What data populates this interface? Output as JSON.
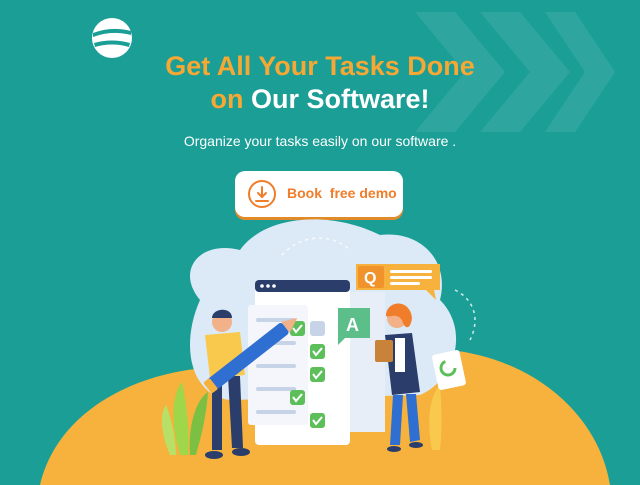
{
  "hero": {
    "title_line1": "Get All Your Tasks Done",
    "title_line2_accent": "on",
    "title_line2_rest": " Our Software!",
    "subtitle": "Organize your tasks easily on our software .",
    "cta_label": "Book  free demo"
  },
  "illustration": {
    "bubble_a_letter": "A",
    "bubble_q_letter": "Q"
  },
  "icons": {
    "logo": "globe-logo-icon",
    "cta": "download-icon",
    "decor": "chevron-right-icon"
  },
  "colors": {
    "background": "#1a9e96",
    "accent_orange": "#f7a733",
    "cta_text": "#ef7d2a",
    "hill": "#f6b23c",
    "blob": "#dbeaf6"
  }
}
